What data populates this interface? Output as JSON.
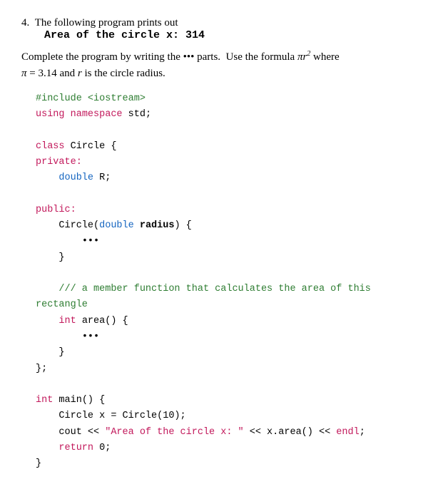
{
  "question": {
    "number": "4.",
    "intro": "The following program prints out",
    "output_label": "Area of the circle x: 314",
    "description_before": "Complete the program by writing the ",
    "dots": "•••",
    "description_middle": " parts.  Use the formula ",
    "pi": "π",
    "r": "r",
    "exponent": "2",
    "description_after": " where",
    "formula_line": "π = 3.14 and r is the circle radius.",
    "code": {
      "line1": "#include <iostream>",
      "line2": "using namespace std;",
      "line3_blank": "",
      "line4": "class Circle {",
      "line5": "private:",
      "line6": "    double R;",
      "line7_blank": "",
      "line8": "public:",
      "line9": "    Circle(double radius) {",
      "line10": "        ...",
      "line11": "    }",
      "line12_blank": "",
      "line13": "    /// a member function that calculates the area of this rectangle",
      "line14": "    int area() {",
      "line15": "        ...",
      "line16": "    }",
      "line17": "};",
      "line18_blank": "",
      "line19": "int main() {",
      "line20": "    Circle x = Circle(10);",
      "line21": "    cout << \"Area of the circle x: \" << x.area() << endl;",
      "line22": "    return 0;",
      "line23": "}"
    }
  }
}
